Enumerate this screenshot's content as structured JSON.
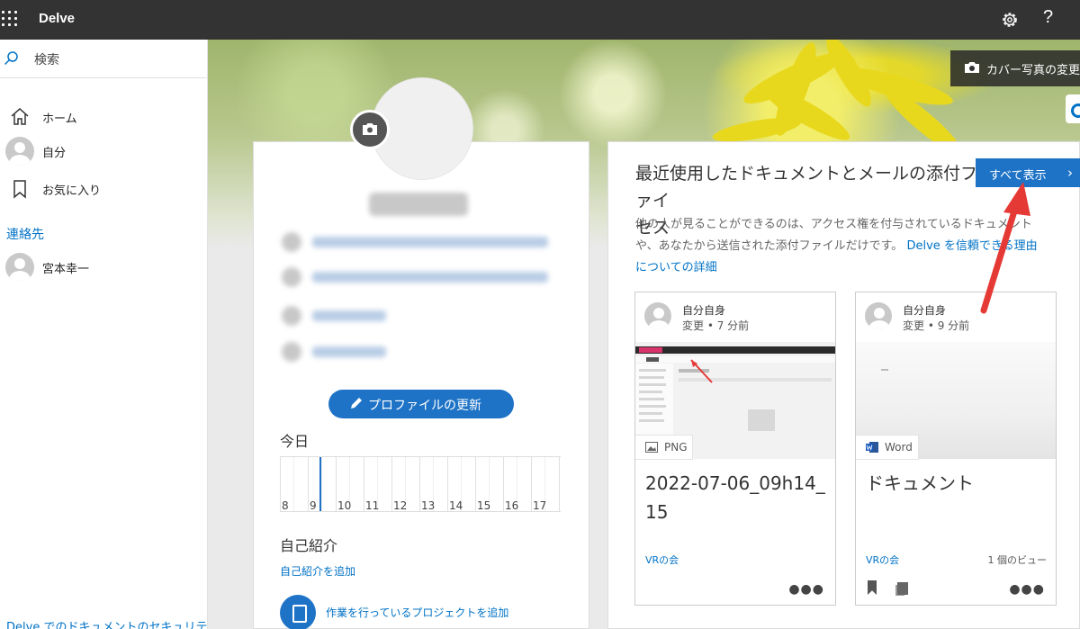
{
  "app": {
    "title": "Delve"
  },
  "sidebar": {
    "search_placeholder": "検索",
    "nav": [
      {
        "label": "ホーム",
        "icon": "home-icon"
      },
      {
        "label": "自分",
        "icon": "avatar"
      },
      {
        "label": "お気に入り",
        "icon": "bookmark-icon"
      }
    ],
    "contacts_heading": "連絡先",
    "contacts": [
      {
        "name": "宮本幸一"
      }
    ],
    "footer_link": "Delve でのドキュメントのセキュリティにつ"
  },
  "banner": {
    "cover_button": "カバー写真の変更"
  },
  "profile": {
    "update_button": "プロファイルの更新",
    "today_label": "今日",
    "timeline_hours": [
      "8",
      "9",
      "10",
      "11",
      "12",
      "13",
      "14",
      "15",
      "16",
      "17"
    ],
    "intro_heading": "自己紹介",
    "intro_add_link": "自己紹介を追加",
    "project_add_link": "作業を行っているプロジェクトを追加"
  },
  "documents": {
    "title": "最近使用したドキュメントとメールの添付ファイル アクセス",
    "title_line1": "最近使用したドキュメントとメールの添付ファイ",
    "title_line2": "セス",
    "description": "他の人が見ることができるのは、アクセス権を付与されているドキュメントや、あなたから送信された添付ファイルだけです。",
    "trust_link": "Delve を信頼できる理由についての詳細",
    "show_all": "すべて表示",
    "cards": [
      {
        "owner": "自分自身",
        "modified": "変更 • 7 分前",
        "type": "PNG",
        "name": "2022-07-06_09h14_15",
        "site": "VRの会",
        "views": ""
      },
      {
        "owner": "自分自身",
        "modified": "変更 • 9 分前",
        "type": "Word",
        "name": "ドキュメント",
        "site": "VRの会",
        "views": "1 個のビュー"
      }
    ]
  },
  "colors": {
    "topbar": "#333333",
    "accent": "#1e73c6",
    "link": "#0072c6",
    "annotation_arrow": "#e53935"
  }
}
